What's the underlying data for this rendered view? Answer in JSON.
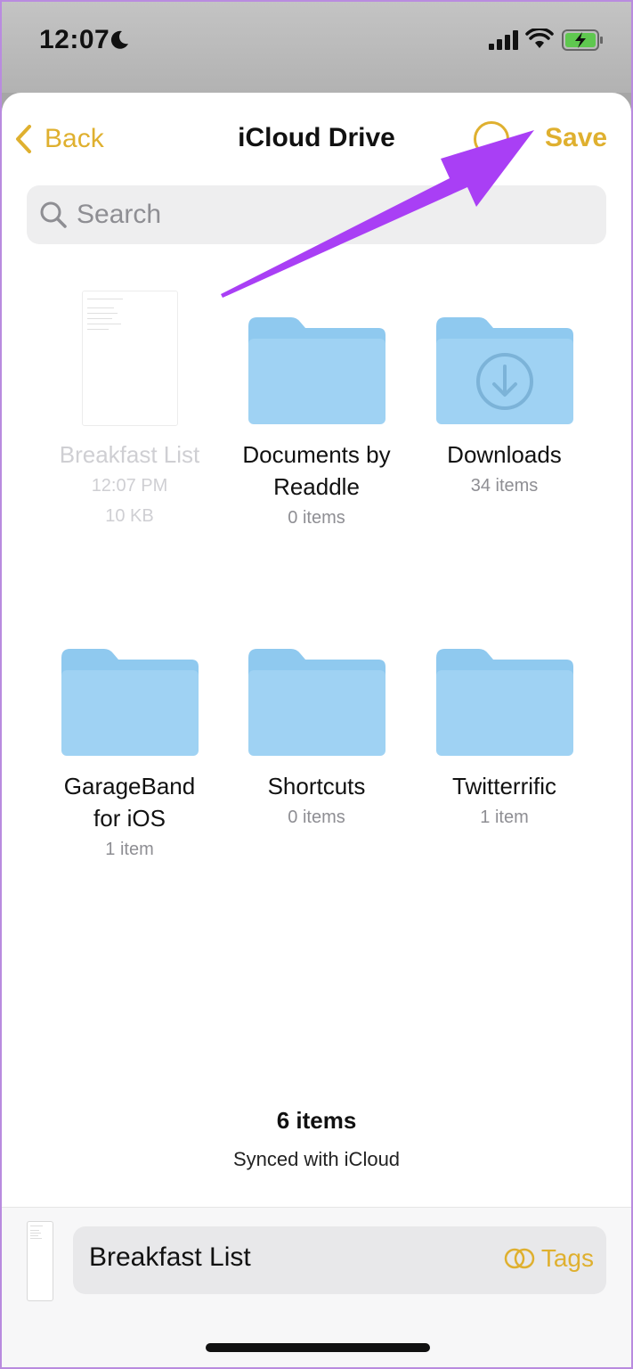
{
  "status_bar": {
    "time": "12:07",
    "icons": [
      "moon-icon",
      "signal-icon",
      "wifi-icon",
      "battery-charging-icon"
    ]
  },
  "nav": {
    "back_label": "Back",
    "title": "iCloud Drive",
    "save_label": "Save",
    "more_icon": "more-circle-icon"
  },
  "search": {
    "placeholder": "Search",
    "value": ""
  },
  "items": [
    {
      "name": "Breakfast List",
      "meta1": "12:07 PM",
      "meta2": "10 KB",
      "type": "document",
      "dimmed": true
    },
    {
      "name": "Documents by Readdle",
      "meta1": "0 items",
      "type": "folder"
    },
    {
      "name": "Downloads",
      "meta1": "34 items",
      "type": "folder-download"
    },
    {
      "name": "GarageBand for iOS",
      "meta1": "1 item",
      "type": "folder"
    },
    {
      "name": "Shortcuts",
      "meta1": "0 items",
      "type": "folder"
    },
    {
      "name": "Twitterrific",
      "meta1": "1 item",
      "type": "folder"
    }
  ],
  "footer": {
    "count": "6 items",
    "sync": "Synced with iCloud"
  },
  "bottom": {
    "filename": "Breakfast List",
    "tags_label": "Tags"
  },
  "colors": {
    "accent": "#dfb02f",
    "folder": "#9fd2f3",
    "annotation_arrow": "#a93ff5"
  }
}
